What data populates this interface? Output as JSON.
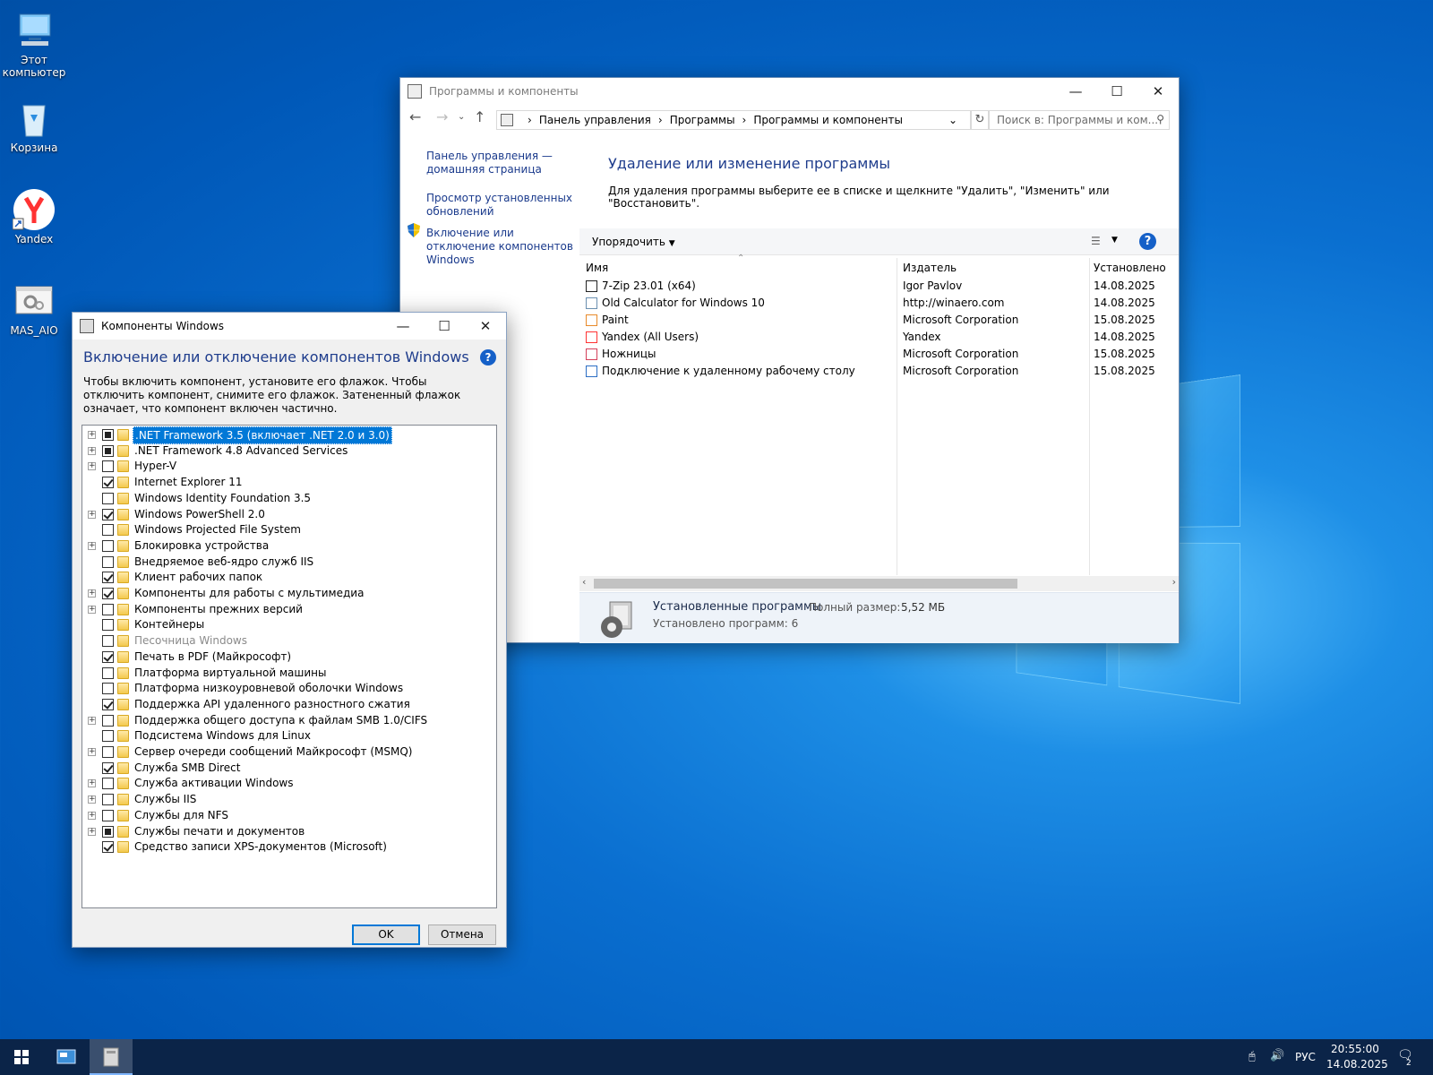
{
  "desktop": {
    "icons": [
      {
        "label_1": "Этот",
        "label_2": "компьютер",
        "icon": "this-pc-icon"
      },
      {
        "label_1": "Корзина",
        "icon": "recycle-bin-icon"
      },
      {
        "label_1": "Yandex",
        "icon": "yandex-browser-icon"
      },
      {
        "label_1": "MAS_AIO",
        "icon": "script-file-icon"
      }
    ]
  },
  "cp_window": {
    "title": "Программы и компоненты",
    "breadcrumb": [
      "Панель управления",
      "Программы",
      "Программы и компоненты"
    ],
    "search_placeholder": "Поиск в: Программы и ком...",
    "sidebar": [
      {
        "label": "Панель управления — домашняя страница"
      },
      {
        "label": "Просмотр установленных обновлений"
      },
      {
        "label": "Включение или отключение компонентов Windows",
        "icon": "uac-shield-icon"
      }
    ],
    "heading": "Удаление или изменение программы",
    "description": "Для удаления программы выберите ее в списке и щелкните \"Удалить\", \"Изменить\" или \"Восстановить\".",
    "organize_label": "Упорядочить",
    "columns": {
      "name": "Имя",
      "publisher": "Издатель",
      "installed": "Установлено"
    },
    "programs": [
      {
        "name": "7-Zip 23.01 (x64)",
        "publisher": "Igor Pavlov",
        "date": "14.08.2025",
        "icon": "7zip-icon"
      },
      {
        "name": "Old Calculator for Windows 10",
        "publisher": "http://winaero.com",
        "date": "14.08.2025",
        "icon": "calculator-icon"
      },
      {
        "name": "Paint",
        "publisher": "Microsoft Corporation",
        "date": "15.08.2025",
        "icon": "paint-icon"
      },
      {
        "name": "Yandex (All Users)",
        "publisher": "Yandex",
        "date": "14.08.2025",
        "icon": "yandex-icon"
      },
      {
        "name": "Ножницы",
        "publisher": "Microsoft Corporation",
        "date": "15.08.2025",
        "icon": "snipping-tool-icon"
      },
      {
        "name": "Подключение к удаленному рабочему столу",
        "publisher": "Microsoft Corporation",
        "date": "15.08.2025",
        "icon": "remote-desktop-icon"
      }
    ],
    "details": {
      "title": "Установленные программы",
      "size_label": "Полный размер:",
      "size_value": "5,52 МБ",
      "count_text": "Установлено программ: 6"
    }
  },
  "features_window": {
    "title": "Компоненты Windows",
    "heading": "Включение или отключение компонентов Windows",
    "description": "Чтобы включить компонент, установите его флажок. Чтобы отключить компонент, снимите его флажок. Затененный флажок означает, что компонент включен частично.",
    "items": [
      {
        "label": ".NET Framework 3.5 (включает .NET 2.0 и 3.0)",
        "state": "partial",
        "expand": true,
        "selected": true
      },
      {
        "label": ".NET Framework 4.8 Advanced Services",
        "state": "partial",
        "expand": true
      },
      {
        "label": "Hyper-V",
        "state": "unchecked",
        "expand": true
      },
      {
        "label": "Internet Explorer 11",
        "state": "checked",
        "expand": false
      },
      {
        "label": "Windows Identity Foundation 3.5",
        "state": "unchecked",
        "expand": false
      },
      {
        "label": "Windows PowerShell 2.0",
        "state": "checked",
        "expand": true
      },
      {
        "label": "Windows Projected File System",
        "state": "unchecked",
        "expand": false
      },
      {
        "label": "Блокировка устройства",
        "state": "unchecked",
        "expand": true
      },
      {
        "label": "Внедряемое веб-ядро служб IIS",
        "state": "unchecked",
        "expand": false
      },
      {
        "label": "Клиент рабочих папок",
        "state": "checked",
        "expand": false
      },
      {
        "label": "Компоненты для работы с мультимедиа",
        "state": "checked",
        "expand": true
      },
      {
        "label": "Компоненты прежних версий",
        "state": "unchecked",
        "expand": true
      },
      {
        "label": "Контейнеры",
        "state": "unchecked",
        "expand": false
      },
      {
        "label": "Песочница Windows",
        "state": "unchecked",
        "expand": false,
        "disabled": true
      },
      {
        "label": "Печать в PDF (Майкрософт)",
        "state": "checked",
        "expand": false
      },
      {
        "label": "Платформа виртуальной машины",
        "state": "unchecked",
        "expand": false
      },
      {
        "label": "Платформа низкоуровневой оболочки Windows",
        "state": "unchecked",
        "expand": false
      },
      {
        "label": "Поддержка API удаленного разностного сжатия",
        "state": "checked",
        "expand": false
      },
      {
        "label": "Поддержка общего доступа к файлам SMB 1.0/CIFS",
        "state": "unchecked",
        "expand": true
      },
      {
        "label": "Подсистема Windows для Linux",
        "state": "unchecked",
        "expand": false
      },
      {
        "label": "Сервер очереди сообщений Майкрософт (MSMQ)",
        "state": "unchecked",
        "expand": true
      },
      {
        "label": "Служба SMB Direct",
        "state": "checked",
        "expand": false
      },
      {
        "label": "Служба активации Windows",
        "state": "unchecked",
        "expand": true
      },
      {
        "label": "Службы IIS",
        "state": "unchecked",
        "expand": true
      },
      {
        "label": "Службы для NFS",
        "state": "unchecked",
        "expand": true
      },
      {
        "label": "Службы печати и документов",
        "state": "partial",
        "expand": true
      },
      {
        "label": "Средство записи XPS-документов (Microsoft)",
        "state": "checked",
        "expand": false
      }
    ],
    "ok_label": "OK",
    "cancel_label": "Отмена"
  },
  "taskbar": {
    "language": "РУС",
    "time": "20:55:00",
    "date": "14.08.2025",
    "notifications": "2"
  },
  "colors": {
    "accent": "#0078d7",
    "link": "#1a3a8c",
    "heading": "#1e3c8c",
    "taskbar": "#0b2448"
  }
}
